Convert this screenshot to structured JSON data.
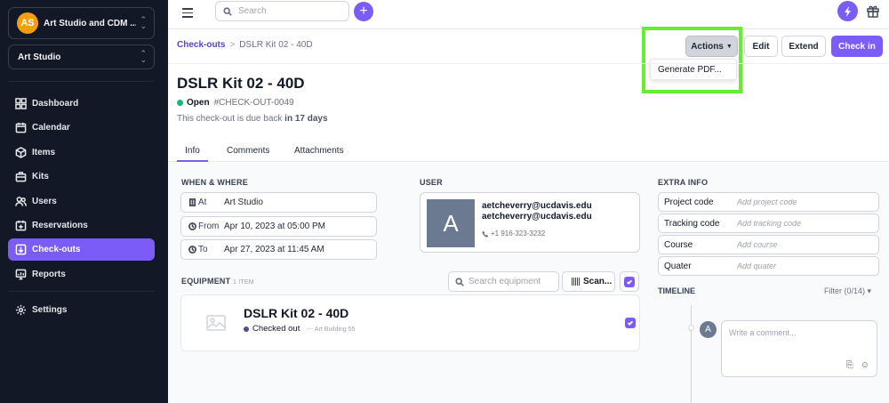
{
  "sidebar": {
    "org": {
      "initials": "AS",
      "name": "Art Studio and CDM ..."
    },
    "location": "Art Studio",
    "items": [
      {
        "label": "Dashboard",
        "icon": "dashboard-icon"
      },
      {
        "label": "Calendar",
        "icon": "calendar-icon"
      },
      {
        "label": "Items",
        "icon": "box-icon"
      },
      {
        "label": "Kits",
        "icon": "kit-icon"
      },
      {
        "label": "Users",
        "icon": "users-icon"
      },
      {
        "label": "Reservations",
        "icon": "calendar-plus-icon"
      },
      {
        "label": "Check-outs",
        "icon": "checkout-icon",
        "active": true
      },
      {
        "label": "Reports",
        "icon": "chart-icon"
      }
    ],
    "settings": {
      "label": "Settings",
      "icon": "gear-icon"
    }
  },
  "topbar": {
    "search_placeholder": "Search",
    "plus": "+"
  },
  "breadcrumb": {
    "parent": "Check-outs",
    "separator": ">",
    "current": "DSLR Kit 02 - 40D"
  },
  "actions": {
    "actions_label": "Actions",
    "edit_label": "Edit",
    "extend_label": "Extend",
    "checkin_label": "Check in",
    "dropdown_item": "Generate PDF..."
  },
  "checkout": {
    "title": "DSLR Kit 02 - 40D",
    "status": "Open",
    "number": "#CHECK-OUT-0049",
    "due_prefix": "This check-out is due back",
    "due_value": "in 17 days"
  },
  "tabs": [
    "Info",
    "Comments",
    "Attachments"
  ],
  "when_where": {
    "label": "WHEN & WHERE",
    "rows": [
      {
        "key": "At",
        "value": "Art Studio"
      },
      {
        "key": "From",
        "value": "Apr 10, 2023 at 05:00 PM"
      },
      {
        "key": "To",
        "value": "Apr 27, 2023 at 11:45 AM"
      }
    ]
  },
  "user": {
    "label": "USER",
    "initial": "A",
    "email1": "aetcheverry@ucdavis.edu",
    "email2": "aetcheverry@ucdavis.edu",
    "phone": "+1 916-323-3232"
  },
  "extra_info": {
    "label": "EXTRA INFO",
    "fields": [
      {
        "key": "Project code",
        "placeholder": "Add project code"
      },
      {
        "key": "Tracking code",
        "placeholder": "Add tracking code"
      },
      {
        "key": "Course",
        "placeholder": "Add course"
      },
      {
        "key": "Quater",
        "placeholder": "Add quater"
      }
    ]
  },
  "equipment": {
    "label": "EQUIPMENT",
    "count": "1 ITEM",
    "search_placeholder": "Search equipment",
    "scan_label": "Scan...",
    "item": {
      "name": "DSLR Kit 02 - 40D",
      "status": "Checked out",
      "location": "Art Building 55"
    }
  },
  "timeline": {
    "label": "TIMELINE",
    "filter": "Filter (0/14)",
    "avatar": "A",
    "comment_placeholder": "Write a comment..."
  }
}
